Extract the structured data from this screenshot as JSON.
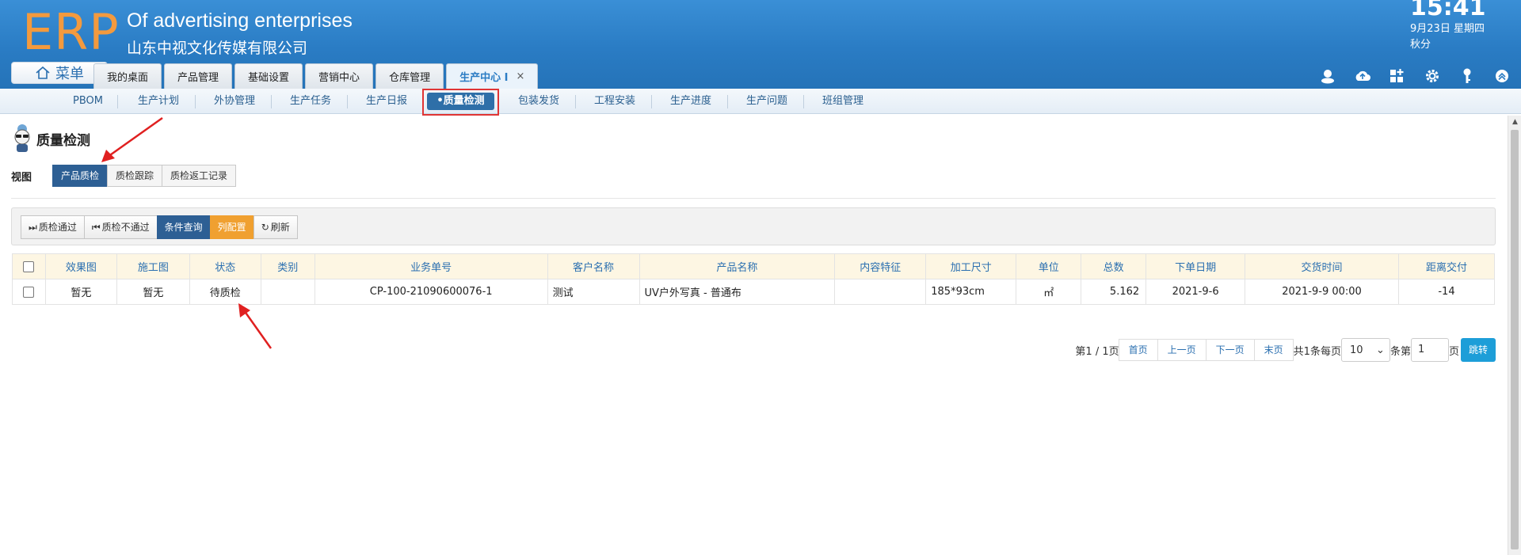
{
  "header": {
    "logo": "ERP",
    "company_en": "Of advertising enterprises",
    "company_cn": "山东中视文化传媒有限公司",
    "time": "15:41",
    "date": "9月23日 星期四",
    "term": "秋分",
    "menu_label": "菜单",
    "tabs": [
      "我的桌面",
      "产品管理",
      "基础设置",
      "营销中心",
      "仓库管理"
    ],
    "active_tab": "生产中心 I",
    "close_symbol": "×"
  },
  "subnav": {
    "items": [
      "PBOM",
      "生产计划",
      "外协管理",
      "生产任务",
      "生产日报",
      "•质量检测",
      "包装发货",
      "工程安装",
      "生产进度",
      "生产问题",
      "班组管理"
    ],
    "active_index": 5
  },
  "page": {
    "title": "质量检测",
    "view_label": "视图",
    "view_buttons": [
      "产品质检",
      "质检跟踪",
      "质检返工记录"
    ],
    "active_view": 0
  },
  "toolbar": {
    "pass": "质检通过",
    "fail": "质检不通过",
    "query": "条件查询",
    "columns": "列配置",
    "refresh": "刷新"
  },
  "table": {
    "headers": [
      "效果图",
      "施工图",
      "状态",
      "类别",
      "业务单号",
      "客户名称",
      "产品名称",
      "内容特征",
      "加工尺寸",
      "单位",
      "总数",
      "下单日期",
      "交货时间",
      "距离交付"
    ],
    "rows": [
      {
        "effect_img": "暂无",
        "construction_img": "暂无",
        "status": "待质检",
        "category": "",
        "order_no": "CP-100-21090600076-1",
        "customer": "测试",
        "product": "UV户外写真 - 普通布",
        "content": "",
        "size": "185*93cm",
        "unit": "㎡",
        "total": "5.162",
        "order_date": "2021-9-6",
        "delivery": "2021-9-9 00:00",
        "days_left": "-14"
      }
    ]
  },
  "pager": {
    "page_info": "第1 / 1页",
    "first": "首页",
    "prev": "上一页",
    "next": "下一页",
    "last": "末页",
    "total_text": "共1条每页",
    "page_size": "10",
    "items_label": "条第",
    "jump_page": "1",
    "page_suffix": "页",
    "go": "跳转"
  },
  "colors": {
    "header_blue": "#2a7cc4",
    "logo_orange": "#f39a3e",
    "active_blue": "#2d5f94",
    "accent_orange": "#f0a030",
    "annotation_red": "#e03535"
  }
}
